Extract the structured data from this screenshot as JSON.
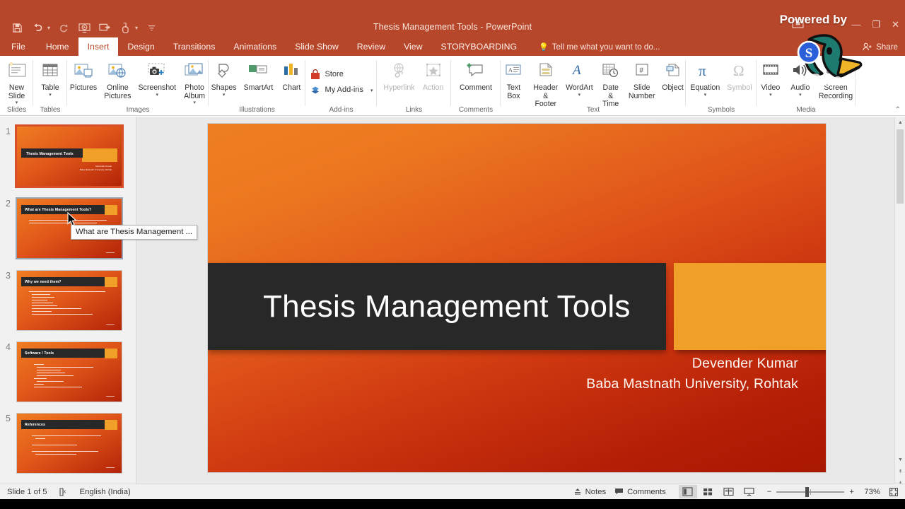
{
  "window": {
    "title": "Thesis Management Tools - PowerPoint",
    "quick_access": [
      {
        "name": "save-icon",
        "label": "Save"
      },
      {
        "name": "undo-icon",
        "label": "Undo"
      },
      {
        "name": "redo-icon",
        "label": "Redo"
      },
      {
        "name": "start-from-beginning-icon",
        "label": "Start From Beginning"
      },
      {
        "name": "start-from-current-slide-icon",
        "label": "Start From Current Slide"
      },
      {
        "name": "touch-mouse-mode-icon",
        "label": "Touch/Mouse Mode"
      },
      {
        "name": "customize-quick-access-toolbar-icon",
        "label": "Customize Quick Access Toolbar"
      }
    ],
    "ribbon_display_options": "Ribbon Display Options",
    "minimize": "—",
    "restore": "❐",
    "close": "✕"
  },
  "watermark": {
    "powered_by": "Powered by",
    "brand": "StreamYard"
  },
  "tabs": [
    {
      "label": "File",
      "active": false
    },
    {
      "label": "Home",
      "active": false
    },
    {
      "label": "Insert",
      "active": true
    },
    {
      "label": "Design",
      "active": false
    },
    {
      "label": "Transitions",
      "active": false
    },
    {
      "label": "Animations",
      "active": false
    },
    {
      "label": "Slide Show",
      "active": false
    },
    {
      "label": "Review",
      "active": false
    },
    {
      "label": "View",
      "active": false
    },
    {
      "label": "STORYBOARDING",
      "active": false
    }
  ],
  "tell_me": "Tell me what you want to do...",
  "share_label": "Share",
  "ribbon": {
    "collapse": "⌃",
    "groups": [
      {
        "name": "Slides",
        "items": [
          {
            "label": "New\nSlide",
            "icon": "new-slide-icon",
            "dropdown": true
          }
        ]
      },
      {
        "name": "Tables",
        "items": [
          {
            "label": "Table",
            "icon": "table-icon",
            "dropdown": true
          }
        ]
      },
      {
        "name": "Images",
        "items": [
          {
            "label": "Pictures",
            "icon": "pictures-icon",
            "dropdown": false
          },
          {
            "label": "Online\nPictures",
            "icon": "online-pictures-icon",
            "dropdown": false
          },
          {
            "label": "Screenshot",
            "icon": "screenshot-icon",
            "dropdown": true
          },
          {
            "label": "Photo\nAlbum",
            "icon": "photo-album-icon",
            "dropdown": true
          }
        ]
      },
      {
        "name": "Illustrations",
        "items": [
          {
            "label": "Shapes",
            "icon": "shapes-icon",
            "dropdown": true
          },
          {
            "label": "SmartArt",
            "icon": "smartart-icon",
            "dropdown": false
          },
          {
            "label": "Chart",
            "icon": "chart-icon",
            "dropdown": false
          }
        ]
      },
      {
        "name": "Add-ins",
        "items": [
          {
            "label": "Store",
            "icon": "store-icon",
            "dropdown": false
          },
          {
            "label": "My Add-ins",
            "icon": "my-addins-icon",
            "dropdown": true
          }
        ]
      },
      {
        "name": "Links",
        "items": [
          {
            "label": "Hyperlink",
            "icon": "hyperlink-icon",
            "disabled": true
          },
          {
            "label": "Action",
            "icon": "action-icon",
            "disabled": true
          }
        ]
      },
      {
        "name": "Comments",
        "items": [
          {
            "label": "Comment",
            "icon": "comment-icon",
            "dropdown": false
          }
        ]
      },
      {
        "name": "Text",
        "items": [
          {
            "label": "Text\nBox",
            "icon": "text-box-icon",
            "dropdown": false
          },
          {
            "label": "Header\n& Footer",
            "icon": "header-footer-icon",
            "dropdown": false
          },
          {
            "label": "WordArt",
            "icon": "wordart-icon",
            "dropdown": true
          },
          {
            "label": "Date &\nTime",
            "icon": "date-time-icon",
            "dropdown": false
          },
          {
            "label": "Slide\nNumber",
            "icon": "slide-number-icon",
            "dropdown": false
          },
          {
            "label": "Object",
            "icon": "object-icon",
            "dropdown": false
          }
        ]
      },
      {
        "name": "Symbols",
        "items": [
          {
            "label": "Equation",
            "icon": "equation-icon",
            "dropdown": true
          },
          {
            "label": "Symbol",
            "icon": "symbol-icon",
            "disabled": true
          }
        ]
      },
      {
        "name": "Media",
        "items": [
          {
            "label": "Video",
            "icon": "video-icon",
            "dropdown": true
          },
          {
            "label": "Audio",
            "icon": "audio-icon",
            "dropdown": true
          },
          {
            "label": "Screen\nRecording",
            "icon": "screen-recording-icon",
            "dropdown": false
          }
        ]
      }
    ]
  },
  "slide_panel": {
    "tooltip": "What are Thesis Management ...",
    "thumbnails": [
      {
        "number": "1",
        "title": "Thesis Management Tools",
        "selected": true,
        "hovered": false,
        "type": "title",
        "sub1": "Devender Kumar",
        "sub2": "Baba Mastnath University, Rohtak"
      },
      {
        "number": "2",
        "title": "What are Thesis Management Tools?",
        "selected": false,
        "hovered": true,
        "type": "content",
        "badge": "2"
      },
      {
        "number": "3",
        "title": "Why we need them?",
        "selected": false,
        "hovered": false,
        "type": "content",
        "badge": "3"
      },
      {
        "number": "4",
        "title": "Software / Tools",
        "selected": false,
        "hovered": false,
        "type": "content",
        "badge": "4"
      },
      {
        "number": "5",
        "title": "References",
        "selected": false,
        "hovered": false,
        "type": "content",
        "badge": "5"
      }
    ]
  },
  "slide": {
    "title": "Thesis Management Tools",
    "author": "Devender Kumar",
    "affiliation": "Baba Mastnath University, Rohtak",
    "colors": {
      "accent_orange": "#f0a028",
      "title_bar": "#282828",
      "bg_from": "#ef7f22",
      "bg_to": "#a81702"
    }
  },
  "status_bar": {
    "slide_counter": "Slide 1 of 5",
    "spellcheck_icon": "spell-check-icon",
    "language": "English (India)",
    "notes": "Notes",
    "comments": "Comments",
    "views": [
      {
        "name": "normal-view-button",
        "active": true
      },
      {
        "name": "slide-sorter-view-button",
        "active": false
      },
      {
        "name": "reading-view-button",
        "active": false
      },
      {
        "name": "slide-show-button",
        "active": false
      }
    ],
    "zoom_out": "−",
    "zoom_in": "+",
    "zoom_percent": "73%",
    "fit_to_window": "fit-slide-to-window-icon"
  }
}
